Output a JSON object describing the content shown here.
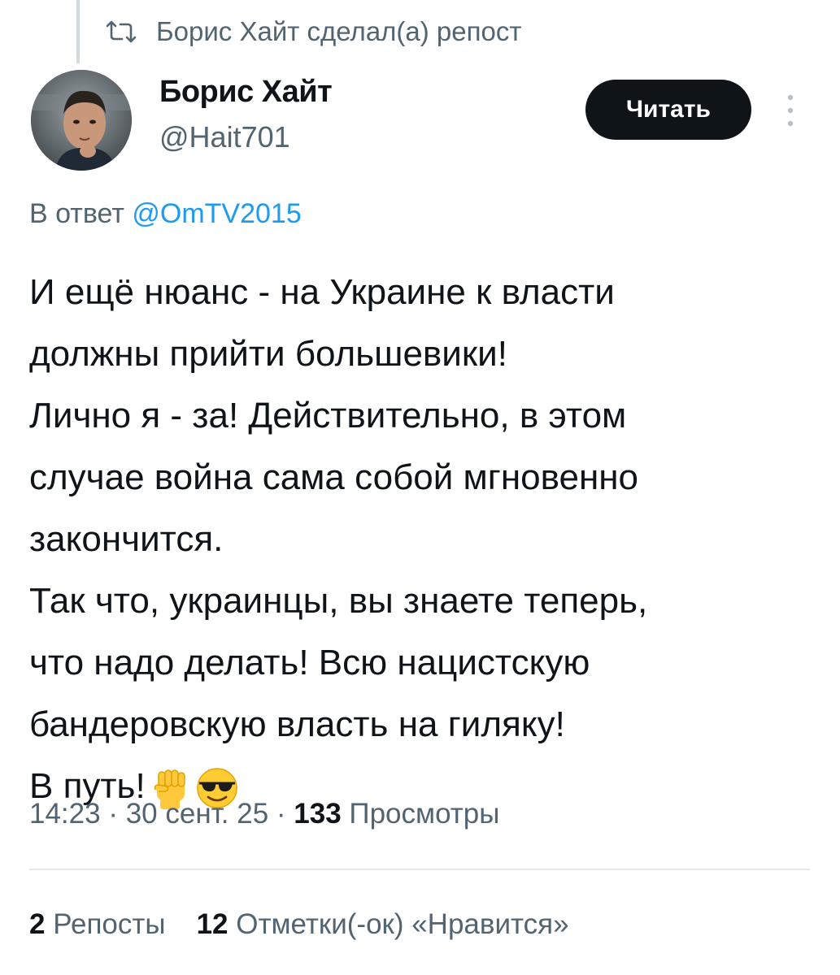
{
  "repost": {
    "icon": "repost-icon",
    "text": "Борис Хайт сделал(а) репост"
  },
  "author": {
    "name": "Борис Хайт",
    "handle": "@Hait701",
    "avatar": "avatar-photo"
  },
  "follow_button": {
    "label": "Читать"
  },
  "more_button": {
    "icon": "more-vertical-icon"
  },
  "reply": {
    "prefix": "В ответ",
    "mention": "@OmTV2015"
  },
  "tweet": {
    "lines": [
      "И ещё нюанс - на Украине к власти",
      "должны прийти большевики!",
      "Лично я - за! Действительно, в этом",
      "случае война сама собой мгновенно",
      "закончится.",
      "Так что, украинцы, вы знаете теперь,",
      "что надо делать! Всю нацистскую",
      "бандеровскую власть на гиляку!",
      "В путь!"
    ],
    "emojis": [
      "raised-fist-emoji",
      "sunglasses-face-emoji"
    ]
  },
  "meta": {
    "time": "14:23",
    "sep1": " · ",
    "date": "30 сент. 25",
    "sep2": " · ",
    "views_count": "133",
    "views_label": " Просмотры"
  },
  "stats": {
    "reposts_count": "2",
    "reposts_label": " Репосты",
    "likes_count": "12",
    "likes_label": " Отметки(-ок) «Нравится»"
  },
  "colors": {
    "text": "#0f1419",
    "secondary": "#536471",
    "link": "#1d9bf0",
    "button_bg": "#0f1419",
    "divider": "#e4e8eb"
  }
}
